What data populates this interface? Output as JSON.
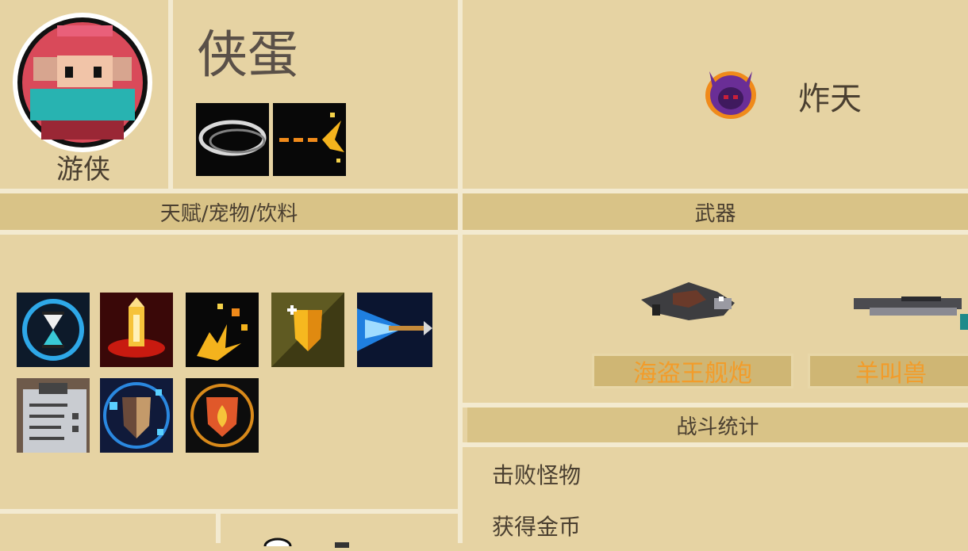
{
  "character": {
    "class_name": "游侠",
    "player_name": "侠蛋"
  },
  "boss": {
    "name": "炸天"
  },
  "sections": {
    "talents_title": "天赋/宠物/饮料",
    "weapons_title": "武器",
    "stats_title": "战斗统计"
  },
  "weapons": [
    {
      "name": "海盗王舰炮"
    },
    {
      "name": "羊叫兽"
    }
  ],
  "stats": [
    {
      "label": "击败怪物"
    },
    {
      "label": "获得金币"
    }
  ],
  "talents": [
    {
      "icon": "hourglass-icon"
    },
    {
      "icon": "bullet-icon"
    },
    {
      "icon": "explosion-icon"
    },
    {
      "icon": "golden-shield-icon"
    },
    {
      "icon": "piercing-arrow-icon"
    },
    {
      "icon": "clipboard-icon"
    },
    {
      "icon": "frost-shield-icon"
    },
    {
      "icon": "fire-shield-icon"
    }
  ],
  "colors": {
    "background": "#e5d19f",
    "band": "#d9c387",
    "weapon_label_text": "#f29c2a",
    "text": "#4a3f30"
  }
}
